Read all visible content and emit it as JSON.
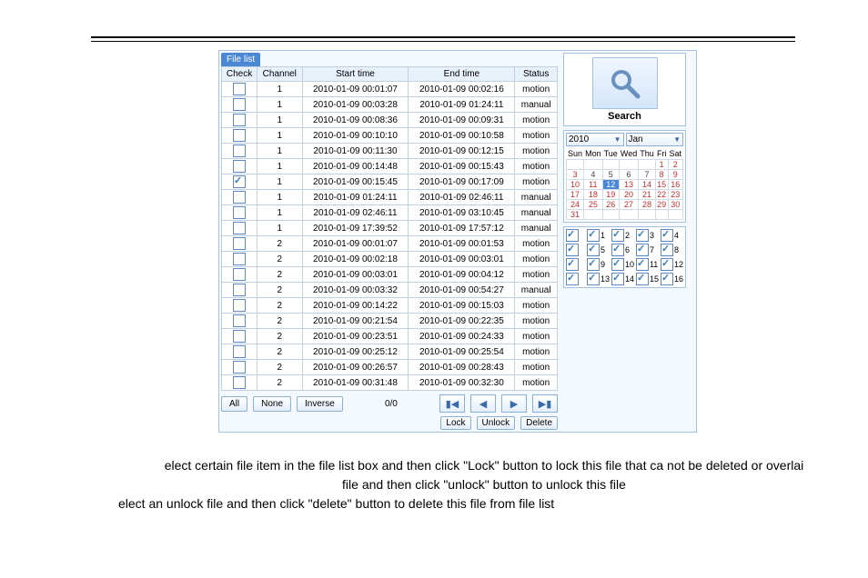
{
  "tab": "File list",
  "columns": [
    "Check",
    "Channel",
    "Start time",
    "End time",
    "Status"
  ],
  "rows": [
    {
      "ck": false,
      "ch": "1",
      "st": "2010-01-09 00:01:07",
      "et": "2010-01-09 00:02:16",
      "status": "motion"
    },
    {
      "ck": false,
      "ch": "1",
      "st": "2010-01-09 00:03:28",
      "et": "2010-01-09 01:24:11",
      "status": "manual"
    },
    {
      "ck": false,
      "ch": "1",
      "st": "2010-01-09 00:08:36",
      "et": "2010-01-09 00:09:31",
      "status": "motion"
    },
    {
      "ck": false,
      "ch": "1",
      "st": "2010-01-09 00:10:10",
      "et": "2010-01-09 00:10:58",
      "status": "motion"
    },
    {
      "ck": false,
      "ch": "1",
      "st": "2010-01-09 00:11:30",
      "et": "2010-01-09 00:12:15",
      "status": "motion"
    },
    {
      "ck": false,
      "ch": "1",
      "st": "2010-01-09 00:14:48",
      "et": "2010-01-09 00:15:43",
      "status": "motion"
    },
    {
      "ck": true,
      "ch": "1",
      "st": "2010-01-09 00:15:45",
      "et": "2010-01-09 00:17:09",
      "status": "motion"
    },
    {
      "ck": false,
      "ch": "1",
      "st": "2010-01-09 01:24:11",
      "et": "2010-01-09 02:46:11",
      "status": "manual"
    },
    {
      "ck": false,
      "ch": "1",
      "st": "2010-01-09 02:46:11",
      "et": "2010-01-09 03:10:45",
      "status": "manual"
    },
    {
      "ck": false,
      "ch": "1",
      "st": "2010-01-09 17:39:52",
      "et": "2010-01-09 17:57:12",
      "status": "manual"
    },
    {
      "ck": false,
      "ch": "2",
      "st": "2010-01-09 00:01:07",
      "et": "2010-01-09 00:01:53",
      "status": "motion"
    },
    {
      "ck": false,
      "ch": "2",
      "st": "2010-01-09 00:02:18",
      "et": "2010-01-09 00:03:01",
      "status": "motion"
    },
    {
      "ck": false,
      "ch": "2",
      "st": "2010-01-09 00:03:01",
      "et": "2010-01-09 00:04:12",
      "status": "motion"
    },
    {
      "ck": false,
      "ch": "2",
      "st": "2010-01-09 00:03:32",
      "et": "2010-01-09 00:54:27",
      "status": "manual"
    },
    {
      "ck": false,
      "ch": "2",
      "st": "2010-01-09 00:14:22",
      "et": "2010-01-09 00:15:03",
      "status": "motion"
    },
    {
      "ck": false,
      "ch": "2",
      "st": "2010-01-09 00:21:54",
      "et": "2010-01-09 00:22:35",
      "status": "motion"
    },
    {
      "ck": false,
      "ch": "2",
      "st": "2010-01-09 00:23:51",
      "et": "2010-01-09 00:24:33",
      "status": "motion"
    },
    {
      "ck": false,
      "ch": "2",
      "st": "2010-01-09 00:25:12",
      "et": "2010-01-09 00:25:54",
      "status": "motion"
    },
    {
      "ck": false,
      "ch": "2",
      "st": "2010-01-09 00:26:57",
      "et": "2010-01-09 00:28:43",
      "status": "motion"
    },
    {
      "ck": false,
      "ch": "2",
      "st": "2010-01-09 00:31:48",
      "et": "2010-01-09 00:32:30",
      "status": "motion"
    }
  ],
  "buttons": {
    "all": "All",
    "none": "None",
    "inverse": "Inverse"
  },
  "pager": {
    "status": "0/0",
    "lock": "Lock",
    "unlock": "Unlock",
    "delete": "Delete"
  },
  "search": {
    "label": "Search",
    "year": "2010",
    "month": "Jan"
  },
  "calendar": {
    "dow": [
      "Sun",
      "Mon",
      "Tue",
      "Wed",
      "Thu",
      "Fri",
      "Sat"
    ],
    "weeks": [
      [
        "",
        "",
        "",
        "",
        "",
        "1",
        "2"
      ],
      [
        "3",
        "4",
        "5",
        "6",
        "7",
        "8",
        "9"
      ],
      [
        "10",
        "11",
        "12",
        "13",
        "14",
        "15",
        "16"
      ],
      [
        "17",
        "18",
        "19",
        "20",
        "21",
        "22",
        "23"
      ],
      [
        "24",
        "25",
        "26",
        "27",
        "28",
        "29",
        "30"
      ],
      [
        "31",
        "",
        "",
        "",
        "",
        "",
        ""
      ]
    ],
    "selected": "12",
    "redRows": [
      2,
      3,
      4,
      5
    ]
  },
  "channels": [
    "1",
    "2",
    "3",
    "4",
    "5",
    "6",
    "7",
    "8",
    "9",
    "10",
    "11",
    "12",
    "13",
    "14",
    "15",
    "16"
  ],
  "instr": {
    "l1": "elect certain file item in the file list box and then click \"Lock\" button to lock this file that ca not be deleted or overlai",
    "l2": "file and then click \"unlock\" button to unlock this file",
    "l3": "elect an unlock file and then click \"delete\" button to delete this file from file list"
  }
}
